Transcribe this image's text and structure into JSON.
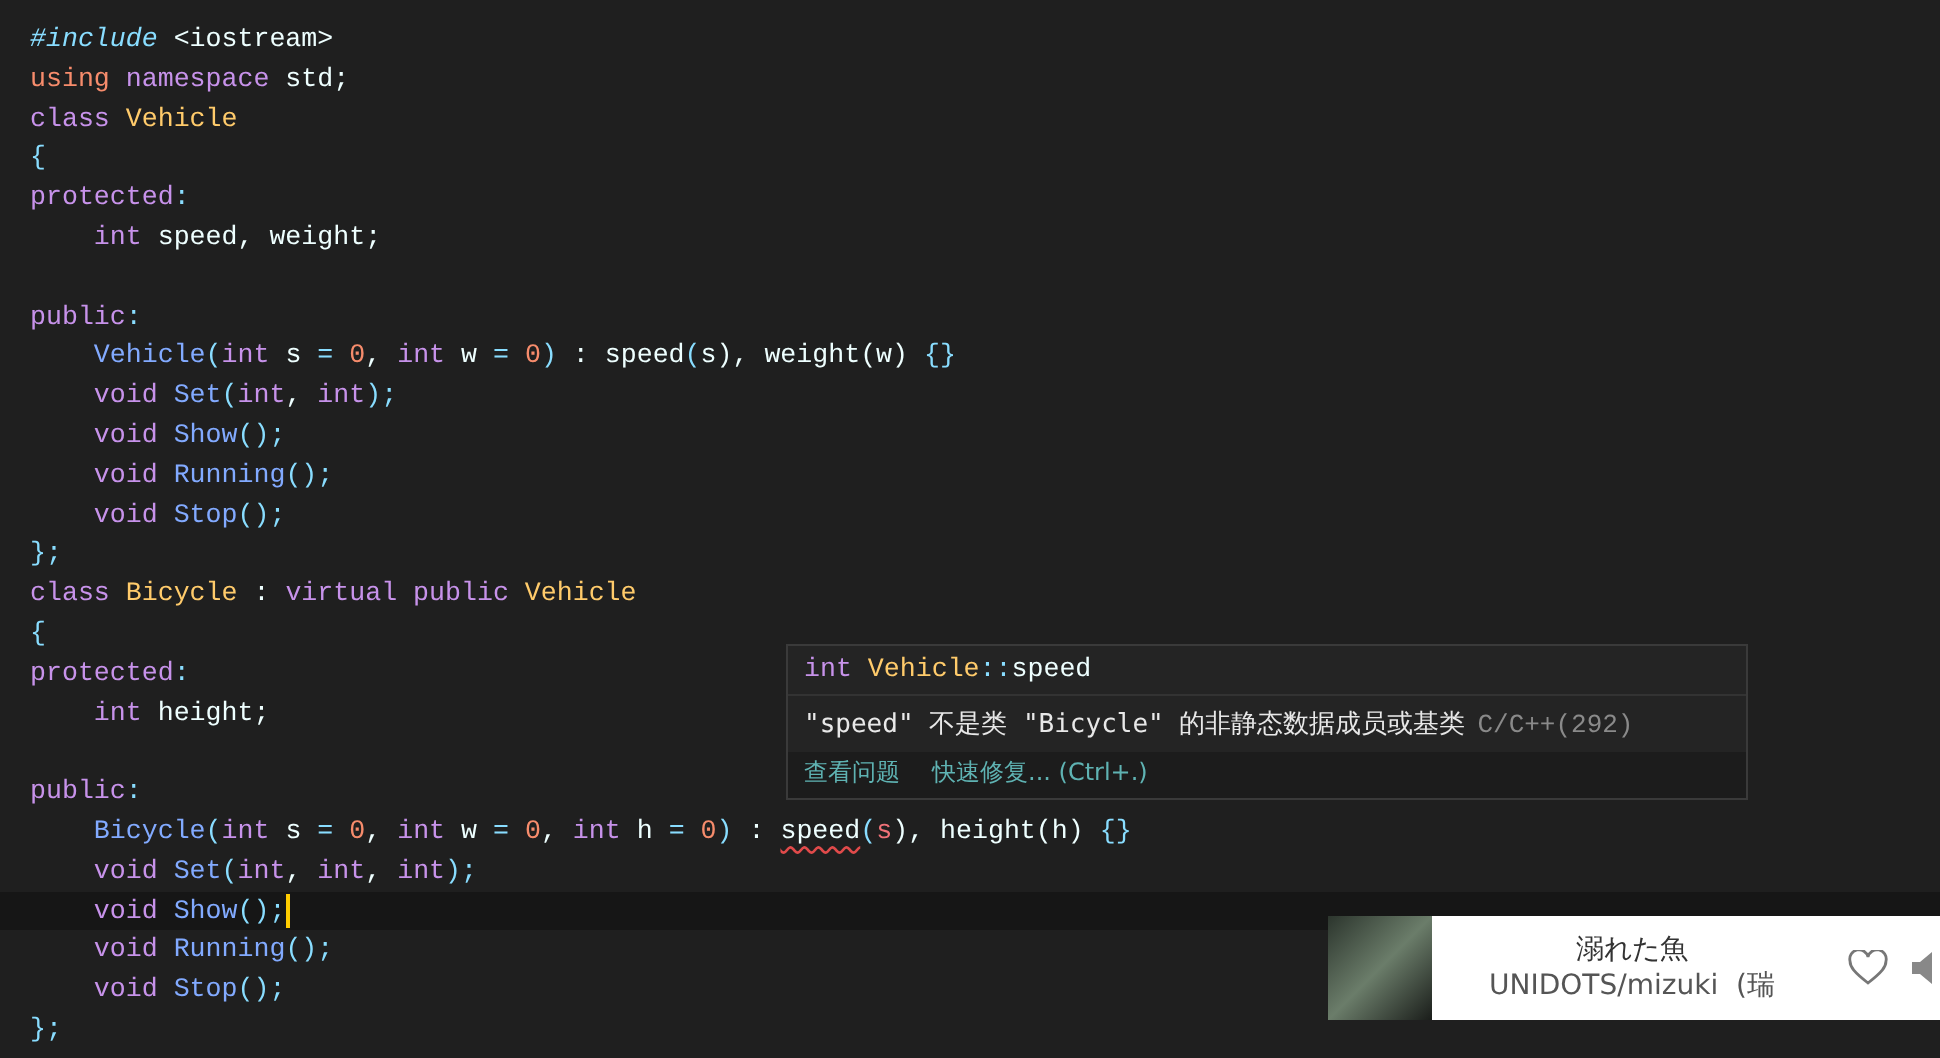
{
  "code": [
    {
      "current": false,
      "tokens": [
        {
          "text": "#include",
          "kind": "pre"
        },
        {
          "text": " <iostream>",
          "kind": "plain"
        }
      ]
    },
    {
      "current": false,
      "tokens": [
        {
          "text": "using",
          "kind": "kw2"
        },
        {
          "text": " namespace",
          "kind": "kw"
        },
        {
          "text": " std;",
          "kind": "plain"
        }
      ]
    },
    {
      "current": false,
      "tokens": [
        {
          "text": "class",
          "kind": "kw"
        },
        {
          "text": " Vehicle",
          "kind": "type"
        }
      ]
    },
    {
      "current": false,
      "tokens": [
        {
          "text": "{",
          "kind": "punct"
        }
      ]
    },
    {
      "current": false,
      "tokens": [
        {
          "text": "protected",
          "kind": "kw"
        },
        {
          "text": ":",
          "kind": "punct"
        }
      ]
    },
    {
      "current": false,
      "tokens": [
        {
          "text": "    int",
          "kind": "kw"
        },
        {
          "text": " speed, weight;",
          "kind": "plain"
        }
      ]
    },
    {
      "current": false
    },
    {
      "current": false,
      "tokens": [
        {
          "text": "public",
          "kind": "kw"
        },
        {
          "text": ":",
          "kind": "punct"
        }
      ]
    },
    {
      "current": false,
      "tokens": [
        {
          "text": "    Vehicle",
          "kind": "func"
        },
        {
          "text": "(",
          "kind": "punct"
        },
        {
          "text": "int",
          "kind": "kw"
        },
        {
          "text": " s ",
          "kind": "plain"
        },
        {
          "text": "=",
          "kind": "punct"
        },
        {
          "text": " 0",
          "kind": "num"
        },
        {
          "text": ", ",
          "kind": "plain"
        },
        {
          "text": "int",
          "kind": "kw"
        },
        {
          "text": " w ",
          "kind": "plain"
        },
        {
          "text": "=",
          "kind": "punct"
        },
        {
          "text": " 0",
          "kind": "num"
        },
        {
          "text": ")",
          "kind": "punct"
        },
        {
          "text": " : speed",
          "kind": "plain"
        },
        {
          "text": "(",
          "kind": "punct"
        },
        {
          "text": "s",
          "kind": "plain"
        },
        {
          "text": "), weight",
          "kind": "plain"
        },
        {
          "text": "(w) ",
          "kind": "plain"
        },
        {
          "text": "{}",
          "kind": "punct"
        }
      ]
    },
    {
      "current": false,
      "tokens": [
        {
          "text": "    void",
          "kind": "kw"
        },
        {
          "text": " Set",
          "kind": "func"
        },
        {
          "text": "(",
          "kind": "punct"
        },
        {
          "text": "int",
          "kind": "kw"
        },
        {
          "text": ", ",
          "kind": "plain"
        },
        {
          "text": "int",
          "kind": "kw"
        },
        {
          "text": ");",
          "kind": "punct"
        }
      ]
    },
    {
      "current": false,
      "tokens": [
        {
          "text": "    void",
          "kind": "kw"
        },
        {
          "text": " Show",
          "kind": "func"
        },
        {
          "text": "();",
          "kind": "punct"
        }
      ]
    },
    {
      "current": false,
      "tokens": [
        {
          "text": "    void",
          "kind": "kw"
        },
        {
          "text": " Running",
          "kind": "func"
        },
        {
          "text": "();",
          "kind": "punct"
        }
      ]
    },
    {
      "current": false,
      "tokens": [
        {
          "text": "    void",
          "kind": "kw"
        },
        {
          "text": " Stop",
          "kind": "func"
        },
        {
          "text": "();",
          "kind": "punct"
        }
      ]
    },
    {
      "current": false,
      "tokens": [
        {
          "text": "};",
          "kind": "punct"
        }
      ]
    },
    {
      "current": false,
      "tokens": [
        {
          "text": "class",
          "kind": "kw"
        },
        {
          "text": " Bicycle",
          "kind": "type"
        },
        {
          "text": " : ",
          "kind": "plain"
        },
        {
          "text": "virtual",
          "kind": "kw"
        },
        {
          "text": " public",
          "kind": "kw"
        },
        {
          "text": " Vehicle",
          "kind": "type"
        }
      ]
    },
    {
      "current": false,
      "tokens": [
        {
          "text": "{",
          "kind": "punct"
        }
      ]
    },
    {
      "current": false,
      "tokens": [
        {
          "text": "protected",
          "kind": "kw"
        },
        {
          "text": ":",
          "kind": "punct"
        }
      ]
    },
    {
      "current": false,
      "tokens": [
        {
          "text": "    int",
          "kind": "kw"
        },
        {
          "text": " height;",
          "kind": "plain"
        }
      ]
    },
    {
      "current": false
    },
    {
      "current": false,
      "tokens": [
        {
          "text": "public",
          "kind": "kw"
        },
        {
          "text": ":",
          "kind": "punct"
        }
      ]
    },
    {
      "current": false,
      "tokens": [
        {
          "text": "    Bicycle",
          "kind": "func"
        },
        {
          "text": "(",
          "kind": "punct"
        },
        {
          "text": "int",
          "kind": "kw"
        },
        {
          "text": " s ",
          "kind": "plain"
        },
        {
          "text": "=",
          "kind": "punct"
        },
        {
          "text": " 0",
          "kind": "num"
        },
        {
          "text": ", ",
          "kind": "plain"
        },
        {
          "text": "int",
          "kind": "kw"
        },
        {
          "text": " w ",
          "kind": "plain"
        },
        {
          "text": "=",
          "kind": "punct"
        },
        {
          "text": " 0",
          "kind": "num"
        },
        {
          "text": ", ",
          "kind": "plain"
        },
        {
          "text": "int",
          "kind": "kw"
        },
        {
          "text": " h ",
          "kind": "plain"
        },
        {
          "text": "=",
          "kind": "punct"
        },
        {
          "text": " 0",
          "kind": "num"
        },
        {
          "text": ")",
          "kind": "punct"
        },
        {
          "text": " : ",
          "kind": "plain"
        },
        {
          "text": "speed",
          "kind": "error"
        },
        {
          "text": "(",
          "kind": "punct"
        },
        {
          "text": "s",
          "kind": "param"
        },
        {
          "text": "), height",
          "kind": "plain"
        },
        {
          "text": "(h) ",
          "kind": "plain"
        },
        {
          "text": "{}",
          "kind": "punct"
        }
      ]
    },
    {
      "current": false,
      "tokens": [
        {
          "text": "    void",
          "kind": "kw"
        },
        {
          "text": " Set",
          "kind": "func"
        },
        {
          "text": "(",
          "kind": "punct"
        },
        {
          "text": "int",
          "kind": "kw"
        },
        {
          "text": ", ",
          "kind": "plain"
        },
        {
          "text": "int",
          "kind": "kw"
        },
        {
          "text": ", ",
          "kind": "plain"
        },
        {
          "text": "int",
          "kind": "kw"
        },
        {
          "text": ");",
          "kind": "punct"
        }
      ]
    },
    {
      "current": true,
      "tokens": [
        {
          "text": "    void",
          "kind": "kw"
        },
        {
          "text": " Show",
          "kind": "func"
        },
        {
          "text": "();",
          "kind": "punct"
        }
      ]
    },
    {
      "current": false,
      "tokens": [
        {
          "text": "    void",
          "kind": "kw"
        },
        {
          "text": " Running",
          "kind": "func"
        },
        {
          "text": "();",
          "kind": "punct"
        }
      ]
    },
    {
      "current": false,
      "tokens": [
        {
          "text": "    void",
          "kind": "kw"
        },
        {
          "text": " Stop",
          "kind": "func"
        },
        {
          "text": "();",
          "kind": "punct"
        }
      ]
    },
    {
      "current": false,
      "tokens": [
        {
          "text": "};",
          "kind": "punct"
        }
      ]
    }
  ],
  "hover": {
    "signature": [
      {
        "text": "int",
        "kind": "kw"
      },
      {
        "text": " Vehicle",
        "kind": "type"
      },
      {
        "text": "::",
        "kind": "punct"
      },
      {
        "text": "speed",
        "kind": "plain"
      }
    ],
    "message": "\"speed\" 不是类 \"Bicycle\" 的非静态数据成员或基类",
    "source": "C/C++(292)",
    "actions": [
      "查看问题",
      "快速修复... (Ctrl+.)"
    ]
  },
  "player": {
    "title": "溺れた魚",
    "artist": "UNIDOTS/mizuki  (瑞"
  }
}
